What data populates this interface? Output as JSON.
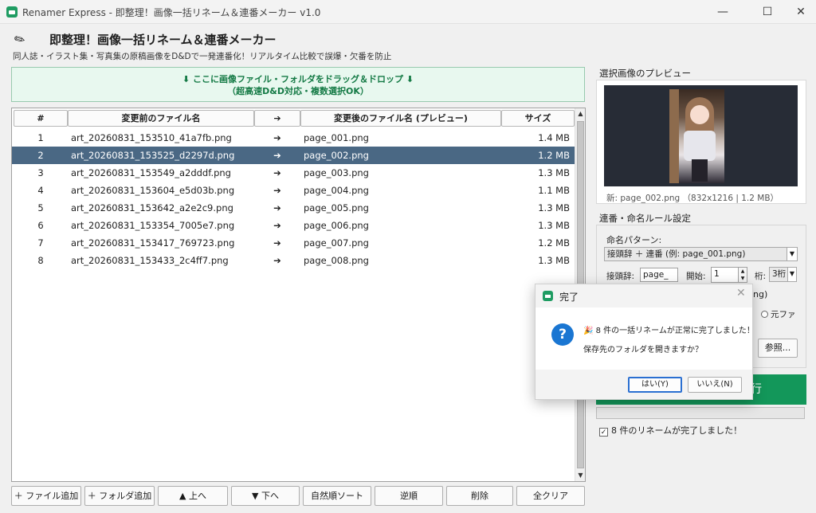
{
  "window": {
    "title": "Renamer Express - 即整理！画像一括リネーム＆連番メーカー v1.0",
    "minimize_glyph": "—",
    "maximize_glyph": "☐",
    "close_glyph": "✕"
  },
  "header": {
    "icon": "eraser-icon",
    "icon_glyph": "✎",
    "title": "即整理！画像一括リネーム＆連番メーカー",
    "subtitle": "同人誌・イラスト集・写真集の原稿画像をD&Dで一発連番化！リアルタイム比較で誤爆・欠番を防止"
  },
  "dropzone": {
    "line1": "⬇ ここに画像ファイル・フォルダをドラッグ＆ドロップ ⬇",
    "line2": "（超高速D&D対応・複数選択OK）"
  },
  "table": {
    "columns": [
      "#",
      "変更前のファイル名",
      "➔",
      "変更後のファイル名 (プレビュー)",
      "サイズ"
    ],
    "rows": [
      {
        "no": "1",
        "old": "art_20260831_153510_41a7fb.png",
        "arrow": "➔",
        "new": "page_001.png",
        "size": "1.4 MB"
      },
      {
        "no": "2",
        "old": "art_20260831_153525_d2297d.png",
        "arrow": "➔",
        "new": "page_002.png",
        "size": "1.2 MB"
      },
      {
        "no": "3",
        "old": "art_20260831_153549_a2dddf.png",
        "arrow": "➔",
        "new": "page_003.png",
        "size": "1.3 MB"
      },
      {
        "no": "4",
        "old": "art_20260831_153604_e5d03b.png",
        "arrow": "➔",
        "new": "page_004.png",
        "size": "1.1 MB"
      },
      {
        "no": "5",
        "old": "art_20260831_153642_a2e2c9.png",
        "arrow": "➔",
        "new": "page_005.png",
        "size": "1.3 MB"
      },
      {
        "no": "6",
        "old": "art_20260831_153354_7005e7.png",
        "arrow": "➔",
        "new": "page_006.png",
        "size": "1.3 MB"
      },
      {
        "no": "7",
        "old": "art_20260831_153417_769723.png",
        "arrow": "➔",
        "new": "page_007.png",
        "size": "1.2 MB"
      },
      {
        "no": "8",
        "old": "art_20260831_153433_2c4ff7.png",
        "arrow": "➔",
        "new": "page_008.png",
        "size": "1.3 MB"
      }
    ],
    "selected_row_index": 1,
    "scroll_up_glyph": "▲",
    "scroll_down_glyph": "▼"
  },
  "buttons": {
    "add_file": "＋ ファイル追加",
    "add_folder": "＋ フォルダ追加",
    "move_up": "▲ 上へ",
    "move_down": "▼ 下へ",
    "natural_sort": "自然順ソート",
    "reverse": "逆順",
    "delete": "削除",
    "clear_all": "全クリア"
  },
  "preview": {
    "section_label": "選択画像のプレビュー",
    "caption": "新: page_002.png （832x1216 | 1.2 MB）"
  },
  "rules": {
    "section_label": "連番・命名ルール設定",
    "pattern_label": "命名パターン:",
    "pattern_value": "接頭辞 ＋ 連番 (例: page_001.png)",
    "prefix_label": "接頭辞:",
    "prefix_value": "page_",
    "start_label": "開始:",
    "start_value": "1",
    "digits_label": "桁:",
    "digits_value": "3桁",
    "partial_label": "ng)",
    "partial_radio": "元ファ",
    "browse_button": "参照...",
    "combo_arrow": "▼",
    "spin_up": "▲",
    "spin_down": "▼"
  },
  "run": {
    "label": "行"
  },
  "progress": {
    "fraction": 0.0
  },
  "status": {
    "check_glyph": "✓",
    "text": "8 件のリネームが完了しました！"
  },
  "dialog": {
    "title": "完了",
    "close_glyph": "✕",
    "icon_glyph": "?",
    "message1": "🎉 8 件の一括リネームが正常に完了しました！",
    "message2": "保存先のフォルダを開きますか？",
    "yes": "はい(Y)",
    "no": "いいえ(N)"
  },
  "colors": {
    "accent_green": "#13975a",
    "selection": "#4a6884",
    "dropzone_bg": "#e8f8ef",
    "dialog_icon": "#1a76d2"
  }
}
